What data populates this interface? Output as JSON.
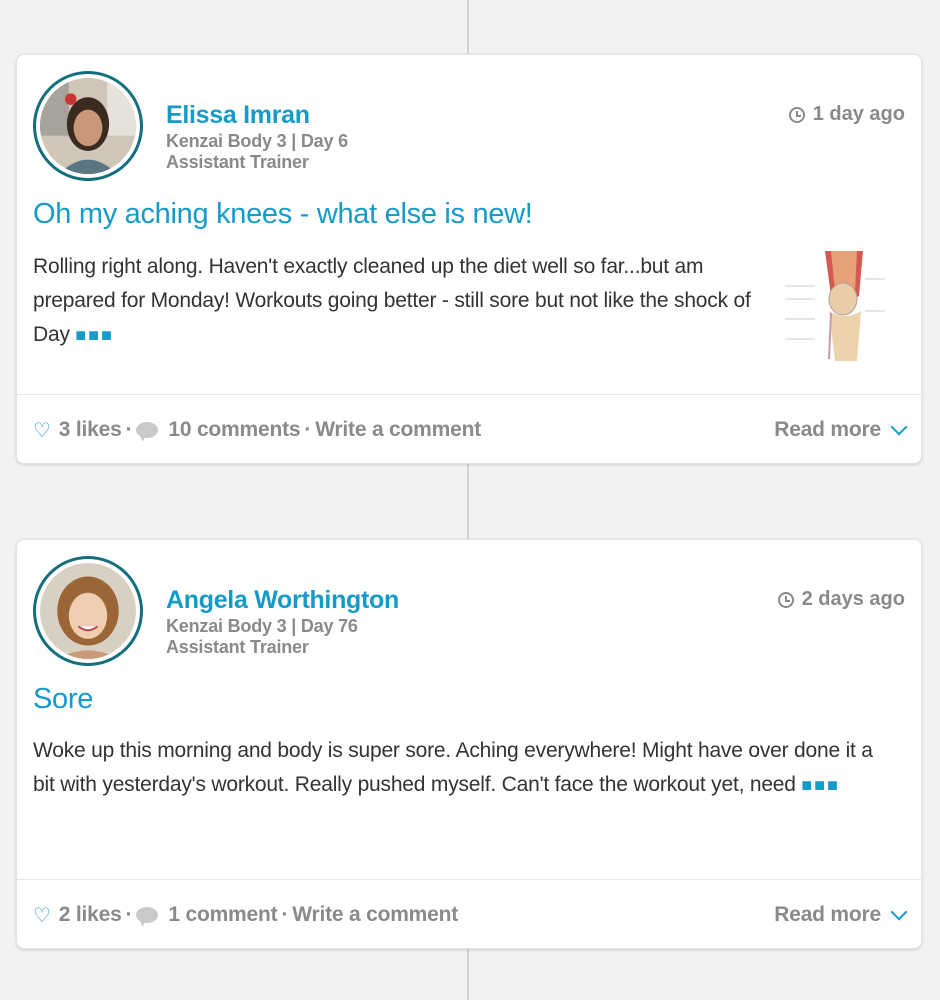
{
  "posts": [
    {
      "author": "Elissa Imran",
      "program": "Kenzai Body 3 | Day 6",
      "role": "Assistant Trainer",
      "time": "1 day ago",
      "title": "Oh my aching knees - what else is new!",
      "excerpt": "Rolling right along. Haven't exactly cleaned up the diet well so far...but am prepared for Monday! Workouts going better - still sore but not like the shock of Day",
      "likes": "3 likes",
      "comments": "10 comments",
      "write_comment": "Write a comment",
      "read_more": "Read more"
    },
    {
      "author": "Angela Worthington",
      "program": "Kenzai Body 3 | Day 76",
      "role": "Assistant Trainer",
      "time": "2 days ago",
      "title": "Sore",
      "excerpt": "Woke up this morning and body is super sore. Aching everywhere! Might have over done it a bit with yesterday's workout. Really pushed myself. Can't face the workout yet, need",
      "likes": "2 likes",
      "comments": "1 comment",
      "write_comment": "Write a comment",
      "read_more": "Read more"
    }
  ],
  "more_indicator": "■■■",
  "separator": "·",
  "icons": {
    "heart": "heart-icon",
    "comment": "comment-bubble-icon",
    "clock": "clock-icon",
    "chevron": "chevron-down-icon"
  },
  "colors": {
    "accent": "#169bc9",
    "muted": "#8a8a8a",
    "avatar_ring": "#136e7e"
  }
}
